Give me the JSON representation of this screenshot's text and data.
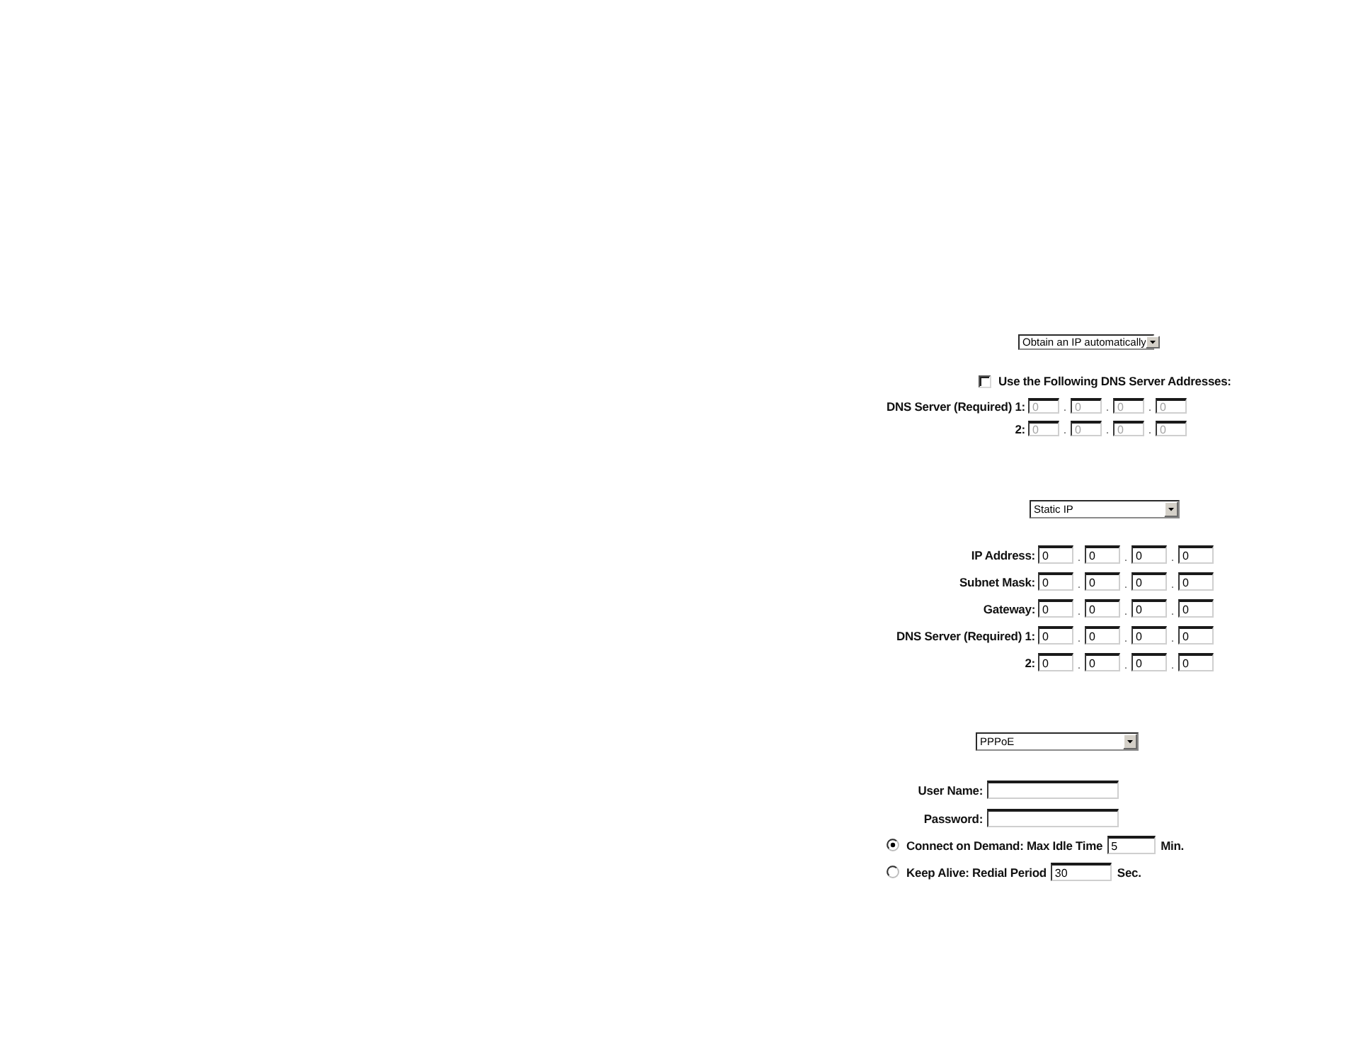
{
  "dhcp_panel": {
    "connection_type": "Obtain an IP automatically",
    "dns_option": {
      "label": "Use the Following DNS Server Addresses:",
      "checked": false
    },
    "address_rows": [
      {
        "label": "DNS Server (Required) 1:",
        "octets": [
          "0",
          "0",
          "0",
          "0"
        ],
        "separators": [
          ".",
          ".",
          "."
        ],
        "disabled": true
      },
      {
        "label": "2:",
        "octets": [
          "0",
          "0",
          "0",
          "0"
        ],
        "separators": [
          ".",
          ".",
          "."
        ],
        "disabled": true
      }
    ]
  },
  "static_panel": {
    "connection_type": "Static IP",
    "address_rows": [
      {
        "label": "IP Address:",
        "octets": [
          "0",
          "0",
          "0",
          "0"
        ],
        "separators": [
          ".",
          ".",
          "."
        ],
        "disabled": false
      },
      {
        "label": "Subnet Mask:",
        "octets": [
          "0",
          "0",
          "0",
          "0"
        ],
        "separators": [
          ".",
          ".",
          "."
        ],
        "disabled": false
      },
      {
        "label": "Gateway:",
        "octets": [
          "0",
          "0",
          "0",
          "0"
        ],
        "separators": [
          ".",
          ".",
          "."
        ],
        "disabled": false
      },
      {
        "label": "DNS Server (Required) 1:",
        "octets": [
          "0",
          "0",
          "0",
          "0"
        ],
        "separators": [
          ".",
          ".",
          "."
        ],
        "disabled": false
      },
      {
        "label": "2:",
        "octets": [
          "0",
          "0",
          "0",
          "0"
        ],
        "separators": [
          ".",
          ".",
          "."
        ],
        "disabled": false
      }
    ]
  },
  "pppoe_panel": {
    "connection_type": "PPPoE",
    "credentials": [
      {
        "label": "User Name:"
      },
      {
        "label": "Password:"
      }
    ],
    "connect_options": [
      {
        "label": "Connect on Demand: Max Idle Time",
        "value": "5",
        "unit": "Min.",
        "selected": true
      },
      {
        "label": "Keep Alive: Redial Period",
        "value": "30",
        "unit": "Sec.",
        "selected": false
      }
    ]
  }
}
